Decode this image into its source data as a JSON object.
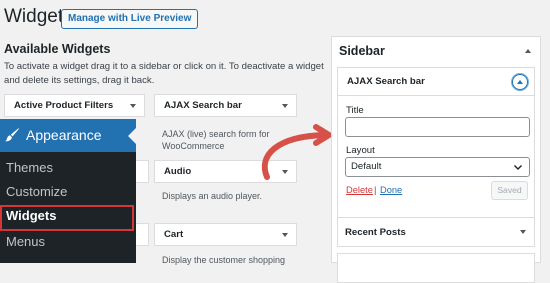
{
  "header": {
    "title": "Widgets",
    "manage_button": "Manage with Live Preview"
  },
  "available": {
    "title": "Available Widgets",
    "description": "To activate a widget drag it to a sidebar or click on it. To deactivate a widget and delete its settings, drag it back."
  },
  "widgets": [
    {
      "title": "Active Product Filters",
      "desc": ""
    },
    {
      "title": "AJAX Search bar",
      "desc": "AJAX (live) search form for WooCommerce"
    },
    {
      "title": "Audio",
      "desc": "Displays an audio player."
    },
    {
      "title": "Cart",
      "desc": "Display the customer shopping"
    }
  ],
  "admin_menu": {
    "section": "Appearance",
    "items": [
      "Themes",
      "Customize",
      "Widgets",
      "Menus"
    ],
    "active": "Widgets",
    "highlight_color": "#d63638",
    "icon": "paintbrush-icon"
  },
  "sidebar": {
    "title": "Sidebar",
    "open_widget": {
      "title": "AJAX Search bar",
      "title_label": "Title",
      "title_value": "",
      "layout_label": "Layout",
      "layout_value": "Default",
      "delete_label": "Delete",
      "separator": "|",
      "done_label": "Done",
      "saved_label": "Saved"
    },
    "other_widgets": [
      "Recent Posts"
    ]
  },
  "colors": {
    "accent": "#2271b1",
    "menu_bg": "#1d2327",
    "arrow": "#d65248"
  }
}
